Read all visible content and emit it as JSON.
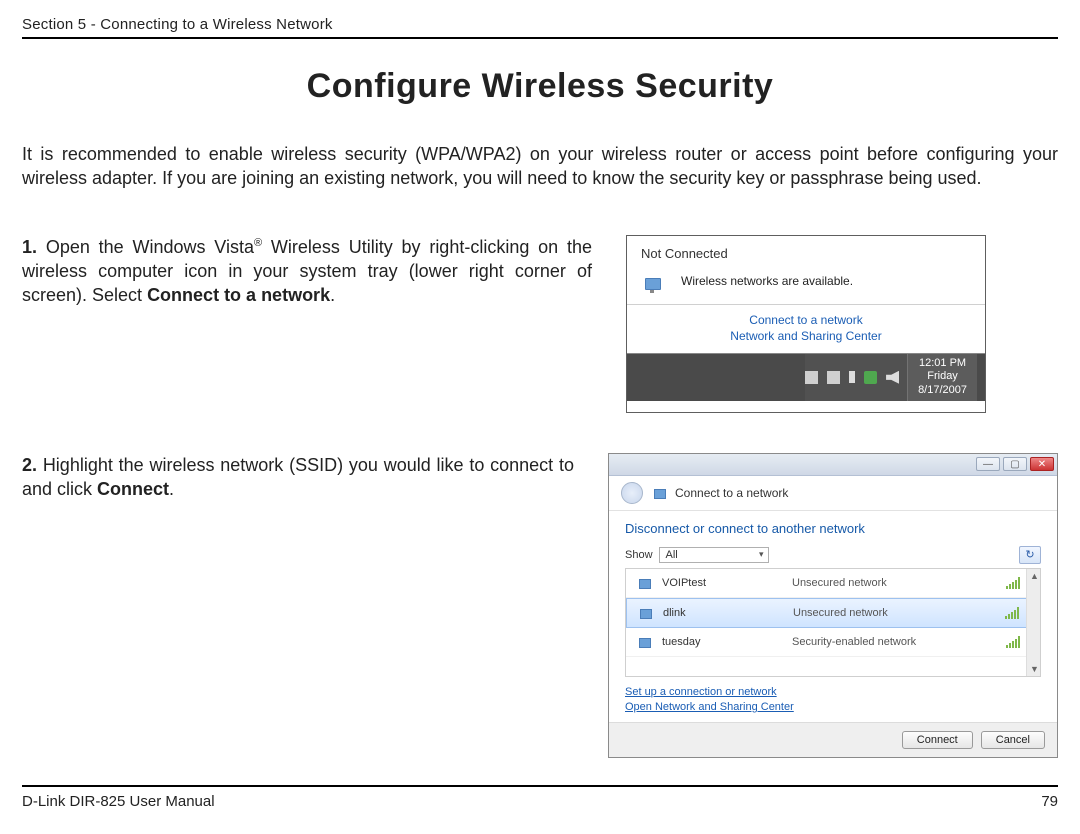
{
  "header": {
    "section": "Section 5 - Connecting to a Wireless Network"
  },
  "title": "Configure Wireless Security",
  "intro": "It is recommended to enable wireless security (WPA/WPA2) on your wireless router or access point before configuring your wireless adapter. If you are joining an existing network, you will need to know the security key or passphrase being used.",
  "step1": {
    "num": "1.",
    "pre": "Open the Windows Vista",
    "reg": "®",
    "mid": " Wireless Utility by right-clicking on the wireless computer icon in your system tray (lower right corner of screen). Select ",
    "bold": "Connect to a network",
    "post": "."
  },
  "step2": {
    "num": "2.",
    "pre": "Highlight the wireless network (SSID) you would like to connect to and click ",
    "bold": "Connect",
    "post": "."
  },
  "fig1": {
    "not_connected": "Not Connected",
    "available": "Wireless networks are available.",
    "link_connect": "Connect to a network",
    "link_center": "Network and Sharing Center",
    "clock": {
      "time": "12:01 PM",
      "day": "Friday",
      "date": "8/17/2007"
    }
  },
  "fig2": {
    "window_title": "Connect to a network",
    "subtitle": "Disconnect or connect to another network",
    "show_label": "Show",
    "show_value": "All",
    "networks": [
      {
        "name": "VOIPtest",
        "type": "Unsecured network",
        "selected": false
      },
      {
        "name": "dlink",
        "type": "Unsecured network",
        "selected": true
      },
      {
        "name": "tuesday",
        "type": "Security-enabled network",
        "selected": false
      }
    ],
    "link_setup": "Set up a connection or network",
    "link_open_center": "Open Network and Sharing Center",
    "btn_connect": "Connect",
    "btn_cancel": "Cancel"
  },
  "footer": {
    "left": "D-Link DIR-825 User Manual",
    "page": "79"
  }
}
